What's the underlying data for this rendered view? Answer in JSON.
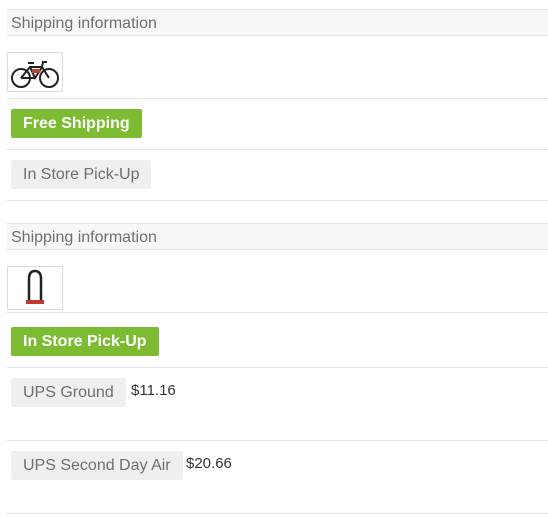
{
  "shipment1": {
    "header": "Shipping information",
    "product_icon": "bicycle-icon",
    "options": [
      {
        "label": "Free Shipping",
        "selected": true,
        "price": ""
      },
      {
        "label": "In Store Pick-Up",
        "selected": false,
        "price": ""
      }
    ]
  },
  "shipment2": {
    "header": "Shipping information",
    "product_icon": "u-lock-icon",
    "options": [
      {
        "label": "In Store Pick-Up",
        "selected": true,
        "price": ""
      },
      {
        "label": "UPS Ground",
        "selected": false,
        "price": "$11.16"
      },
      {
        "label": "UPS Second Day Air",
        "selected": false,
        "price": "$20.66"
      }
    ]
  },
  "colors": {
    "selected": "#7dbc32",
    "unselected": "#efefef",
    "header_bg": "#f7f7f7"
  }
}
